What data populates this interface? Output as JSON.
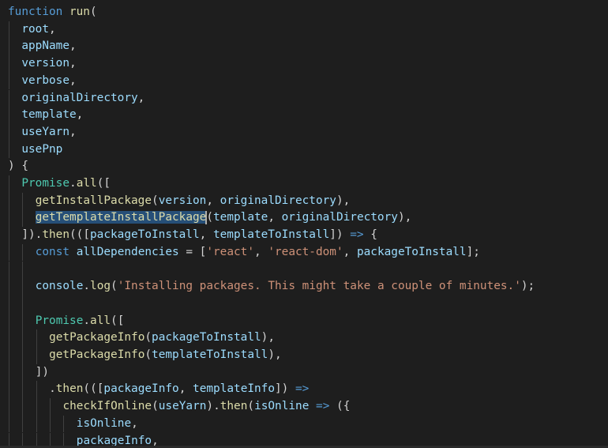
{
  "editor": {
    "colors": {
      "background": "#1e1e1e",
      "keyword": "#569cd6",
      "variable": "#9cdcfe",
      "function": "#dcdcaa",
      "class": "#4ec9b0",
      "string": "#ce9178",
      "punctuation": "#d4d4d4",
      "selection": "#264f78"
    },
    "lines": [
      {
        "indent": 0,
        "tokens": [
          {
            "t": "function",
            "c": "function"
          },
          {
            "t": " ",
            "c": "plain"
          },
          {
            "t": "run",
            "c": "method"
          },
          {
            "t": "(",
            "c": "punct"
          }
        ]
      },
      {
        "indent": 1,
        "tokens": [
          {
            "t": "root",
            "c": "param"
          },
          {
            "t": ",",
            "c": "punct"
          }
        ]
      },
      {
        "indent": 1,
        "tokens": [
          {
            "t": "appName",
            "c": "param"
          },
          {
            "t": ",",
            "c": "punct"
          }
        ]
      },
      {
        "indent": 1,
        "tokens": [
          {
            "t": "version",
            "c": "param"
          },
          {
            "t": ",",
            "c": "punct"
          }
        ]
      },
      {
        "indent": 1,
        "tokens": [
          {
            "t": "verbose",
            "c": "param"
          },
          {
            "t": ",",
            "c": "punct"
          }
        ]
      },
      {
        "indent": 1,
        "tokens": [
          {
            "t": "originalDirectory",
            "c": "param"
          },
          {
            "t": ",",
            "c": "punct"
          }
        ]
      },
      {
        "indent": 1,
        "tokens": [
          {
            "t": "template",
            "c": "param"
          },
          {
            "t": ",",
            "c": "punct"
          }
        ]
      },
      {
        "indent": 1,
        "tokens": [
          {
            "t": "useYarn",
            "c": "param"
          },
          {
            "t": ",",
            "c": "punct"
          }
        ]
      },
      {
        "indent": 1,
        "tokens": [
          {
            "t": "usePnp",
            "c": "param"
          }
        ]
      },
      {
        "indent": 0,
        "tokens": [
          {
            "t": ") {",
            "c": "punct"
          }
        ]
      },
      {
        "indent": 1,
        "tokens": [
          {
            "t": "Promise",
            "c": "class"
          },
          {
            "t": ".",
            "c": "punct"
          },
          {
            "t": "all",
            "c": "method"
          },
          {
            "t": "([",
            "c": "punct"
          }
        ]
      },
      {
        "indent": 2,
        "tokens": [
          {
            "t": "getInstallPackage",
            "c": "method"
          },
          {
            "t": "(",
            "c": "punct"
          },
          {
            "t": "version",
            "c": "param"
          },
          {
            "t": ", ",
            "c": "punct"
          },
          {
            "t": "originalDirectory",
            "c": "param"
          },
          {
            "t": "),",
            "c": "punct"
          }
        ]
      },
      {
        "indent": 2,
        "tokens": [
          {
            "t": "getTemplateInstallPackage",
            "c": "selected"
          },
          {
            "t": "",
            "c": "cursor"
          },
          {
            "t": "(",
            "c": "punct"
          },
          {
            "t": "template",
            "c": "param"
          },
          {
            "t": ", ",
            "c": "punct"
          },
          {
            "t": "originalDirectory",
            "c": "param"
          },
          {
            "t": "),",
            "c": "punct"
          }
        ]
      },
      {
        "indent": 1,
        "tokens": [
          {
            "t": "]).",
            "c": "punct"
          },
          {
            "t": "then",
            "c": "method"
          },
          {
            "t": "(([",
            "c": "punct"
          },
          {
            "t": "packageToInstall",
            "c": "param"
          },
          {
            "t": ", ",
            "c": "punct"
          },
          {
            "t": "templateToInstall",
            "c": "param"
          },
          {
            "t": "]) ",
            "c": "punct"
          },
          {
            "t": "=>",
            "c": "keyword"
          },
          {
            "t": " {",
            "c": "punct"
          }
        ]
      },
      {
        "indent": 2,
        "tokens": [
          {
            "t": "const",
            "c": "keyword"
          },
          {
            "t": " ",
            "c": "plain"
          },
          {
            "t": "allDependencies",
            "c": "param"
          },
          {
            "t": " = [",
            "c": "punct"
          },
          {
            "t": "'react'",
            "c": "string"
          },
          {
            "t": ", ",
            "c": "punct"
          },
          {
            "t": "'react-dom'",
            "c": "string"
          },
          {
            "t": ", ",
            "c": "punct"
          },
          {
            "t": "packageToInstall",
            "c": "param"
          },
          {
            "t": "];",
            "c": "punct"
          }
        ]
      },
      {
        "indent": 2,
        "tokens": []
      },
      {
        "indent": 2,
        "tokens": [
          {
            "t": "console",
            "c": "param"
          },
          {
            "t": ".",
            "c": "punct"
          },
          {
            "t": "log",
            "c": "method"
          },
          {
            "t": "(",
            "c": "punct"
          },
          {
            "t": "'Installing packages. This might take a couple of minutes.'",
            "c": "string"
          },
          {
            "t": ");",
            "c": "punct"
          }
        ]
      },
      {
        "indent": 2,
        "tokens": []
      },
      {
        "indent": 2,
        "tokens": [
          {
            "t": "Promise",
            "c": "class"
          },
          {
            "t": ".",
            "c": "punct"
          },
          {
            "t": "all",
            "c": "method"
          },
          {
            "t": "([",
            "c": "punct"
          }
        ]
      },
      {
        "indent": 3,
        "tokens": [
          {
            "t": "getPackageInfo",
            "c": "method"
          },
          {
            "t": "(",
            "c": "punct"
          },
          {
            "t": "packageToInstall",
            "c": "param"
          },
          {
            "t": "),",
            "c": "punct"
          }
        ]
      },
      {
        "indent": 3,
        "tokens": [
          {
            "t": "getPackageInfo",
            "c": "method"
          },
          {
            "t": "(",
            "c": "punct"
          },
          {
            "t": "templateToInstall",
            "c": "param"
          },
          {
            "t": "),",
            "c": "punct"
          }
        ]
      },
      {
        "indent": 2,
        "tokens": [
          {
            "t": "])",
            "c": "punct"
          }
        ]
      },
      {
        "indent": 3,
        "tokens": [
          {
            "t": ".",
            "c": "punct"
          },
          {
            "t": "then",
            "c": "method"
          },
          {
            "t": "(([",
            "c": "punct"
          },
          {
            "t": "packageInfo",
            "c": "param"
          },
          {
            "t": ", ",
            "c": "punct"
          },
          {
            "t": "templateInfo",
            "c": "param"
          },
          {
            "t": "]) ",
            "c": "punct"
          },
          {
            "t": "=>",
            "c": "keyword"
          }
        ]
      },
      {
        "indent": 4,
        "tokens": [
          {
            "t": "checkIfOnline",
            "c": "method"
          },
          {
            "t": "(",
            "c": "punct"
          },
          {
            "t": "useYarn",
            "c": "param"
          },
          {
            "t": ").",
            "c": "punct"
          },
          {
            "t": "then",
            "c": "method"
          },
          {
            "t": "(",
            "c": "punct"
          },
          {
            "t": "isOnline",
            "c": "param"
          },
          {
            "t": " ",
            "c": "plain"
          },
          {
            "t": "=>",
            "c": "keyword"
          },
          {
            "t": " ({",
            "c": "punct"
          }
        ]
      },
      {
        "indent": 5,
        "tokens": [
          {
            "t": "isOnline",
            "c": "param"
          },
          {
            "t": ",",
            "c": "punct"
          }
        ]
      },
      {
        "indent": 5,
        "tokens": [
          {
            "t": "packageInfo",
            "c": "param"
          },
          {
            "t": ",",
            "c": "punct"
          }
        ]
      }
    ]
  }
}
